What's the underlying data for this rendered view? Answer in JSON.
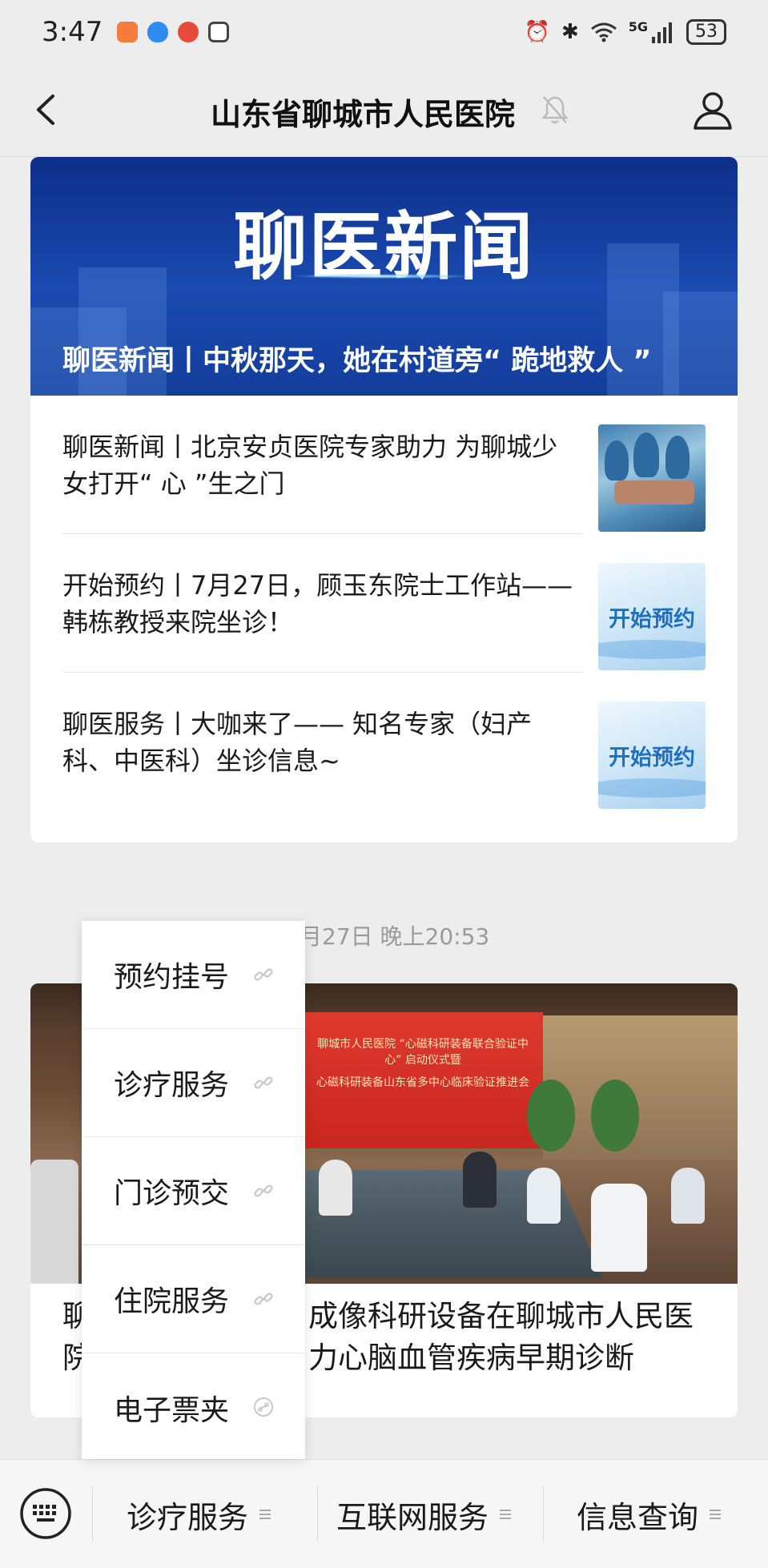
{
  "status_bar": {
    "time": "3:47",
    "network": "5G",
    "battery": "53",
    "colors": {
      "app1": "#f57c3a",
      "app2": "#2f8bf0",
      "app3": "#e84a3a",
      "app4": "#444444"
    }
  },
  "nav": {
    "title": "山东省聊城市人民医院",
    "icons": [
      "chevron-left-icon",
      "bell-mute-icon",
      "user-icon"
    ]
  },
  "article1": {
    "banner_heading": "聊医新闻",
    "banner_caption": "聊医新闻丨中秋那天，她在村道旁“ 跪地救人 ”",
    "items": [
      {
        "title": "聊医新闻丨北京安贞医院专家助力 为聊城少女打开“ 心 ”生之门",
        "thumb": "surgery-photo"
      },
      {
        "title": "开始预约丨7月27日，顾玉东院士工作站——韩栋教授来院坐诊！",
        "thumb_text": "开始预约"
      },
      {
        "title": "聊医服务丨大咖来了—— 知名专家（妇产科、中医科）坐诊信息~",
        "thumb_text": "开始预约"
      }
    ]
  },
  "timestamp": "月27日 晚上20:53",
  "article2": {
    "title": "聊城市人民医院合作成像科研设备在聊城市人民医院完成验证，助力心脑血管疾病早期诊断",
    "visible_title_line1_right": "成像科研设备在聊城市人民医",
    "visible_title_line2_right": "力心脑血管疾病早期诊断",
    "visible_title_prefix1": "聊",
    "visible_title_prefix2": "院",
    "photo_screen_lines": [
      "聊城市人民医院 “心磁科研装备联合验证中心” 启动仪式暨",
      "心磁科研装备山东省多中心临床验证推进会"
    ]
  },
  "popup_menu": {
    "items": [
      {
        "label": "预约挂号",
        "icon": "link-icon"
      },
      {
        "label": "诊疗服务",
        "icon": "link-icon"
      },
      {
        "label": "门诊预交",
        "icon": "link-icon"
      },
      {
        "label": "住院服务",
        "icon": "link-icon"
      },
      {
        "label": "电子票夹",
        "icon": "mini-program-icon"
      }
    ]
  },
  "bottom_menu": {
    "items": [
      {
        "label": "诊疗服务"
      },
      {
        "label": "互联网服务"
      },
      {
        "label": "信息查询"
      }
    ]
  }
}
